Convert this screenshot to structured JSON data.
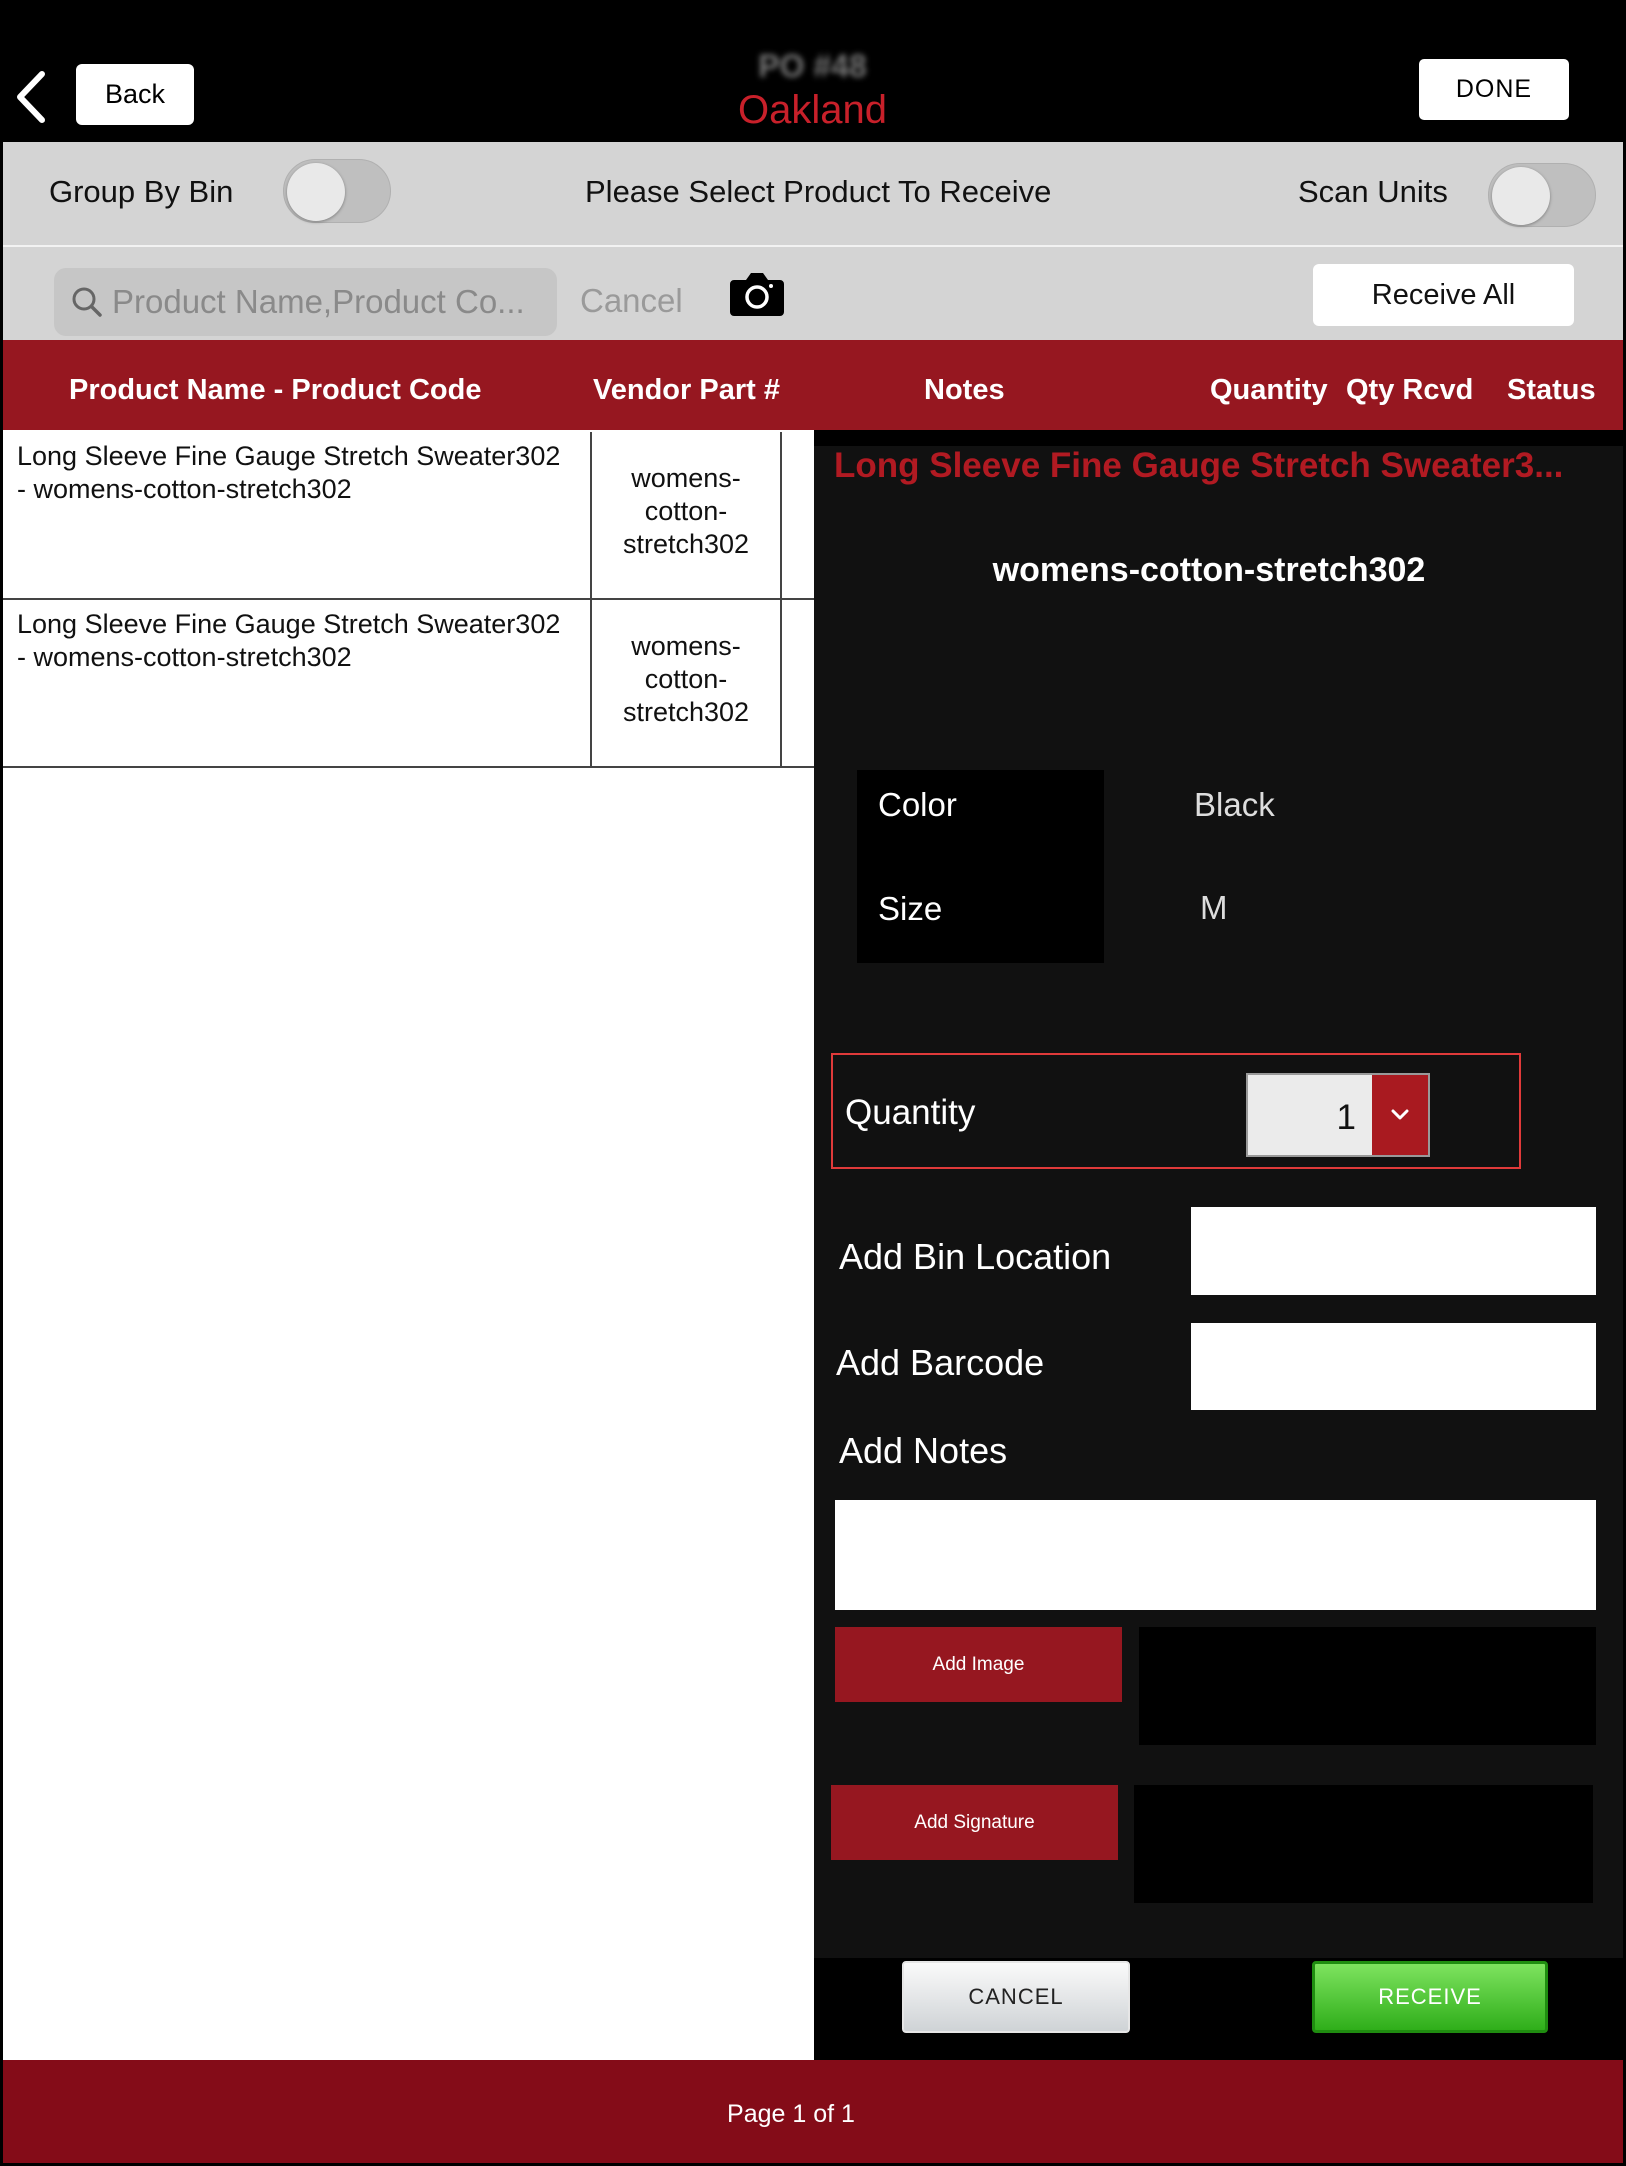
{
  "nav": {
    "back_label": "Back",
    "title_po": "PO #48",
    "title_location": "Oakland",
    "done_label": "DONE"
  },
  "toolbar": {
    "group_by_bin_label": "Group By Bin",
    "group_by_bin_on": false,
    "instruction": "Please Select Product To Receive",
    "scan_units_label": "Scan Units",
    "scan_units_on": false,
    "search_placeholder": "Product Name,Product Co...",
    "search_value": "",
    "cancel_label": "Cancel",
    "receive_all_label": "Receive All"
  },
  "table": {
    "columns": [
      "Product Name - Product Code",
      "Vendor Part #",
      "Notes",
      "Quantity",
      "Qty Rcvd",
      "Status"
    ],
    "rows": [
      {
        "name_line1": "Long Sleeve Fine Gauge Stretch Sweater302",
        "name_line2": "- womens-cotton-stretch302",
        "vendor_part_lines": [
          "womens-",
          "cotton-",
          "stretch302"
        ]
      },
      {
        "name_line1": "Long Sleeve Fine Gauge Stretch Sweater302",
        "name_line2": "- womens-cotton-stretch302",
        "vendor_part_lines": [
          "womens-",
          "cotton-",
          "stretch302"
        ]
      }
    ]
  },
  "detail": {
    "product_name": "Long Sleeve Fine Gauge Stretch Sweater3...",
    "product_code": "womens-cotton-stretch302",
    "attributes": [
      {
        "label": "Color",
        "value": "Black"
      },
      {
        "label": "Size",
        "value": "M"
      }
    ],
    "quantity_label": "Quantity",
    "quantity_value": "1",
    "bin_location_label": "Add Bin Location",
    "bin_location_value": "",
    "barcode_label": "Add Barcode",
    "barcode_value": "",
    "notes_label": "Add Notes",
    "notes_value": "",
    "add_image_label": "Add Image",
    "add_signature_label": "Add Signature",
    "cancel_label": "CANCEL",
    "receive_label": "RECEIVE"
  },
  "footer": {
    "page_text": "Page 1 of 1"
  },
  "colors": {
    "brand_red": "#961720",
    "footer_red": "#840c18",
    "receive_green": "#3fc02a"
  },
  "icons": {
    "back": "chevron-left-icon",
    "search": "search-icon",
    "camera": "camera-icon",
    "dropdown": "chevron-down-icon"
  }
}
